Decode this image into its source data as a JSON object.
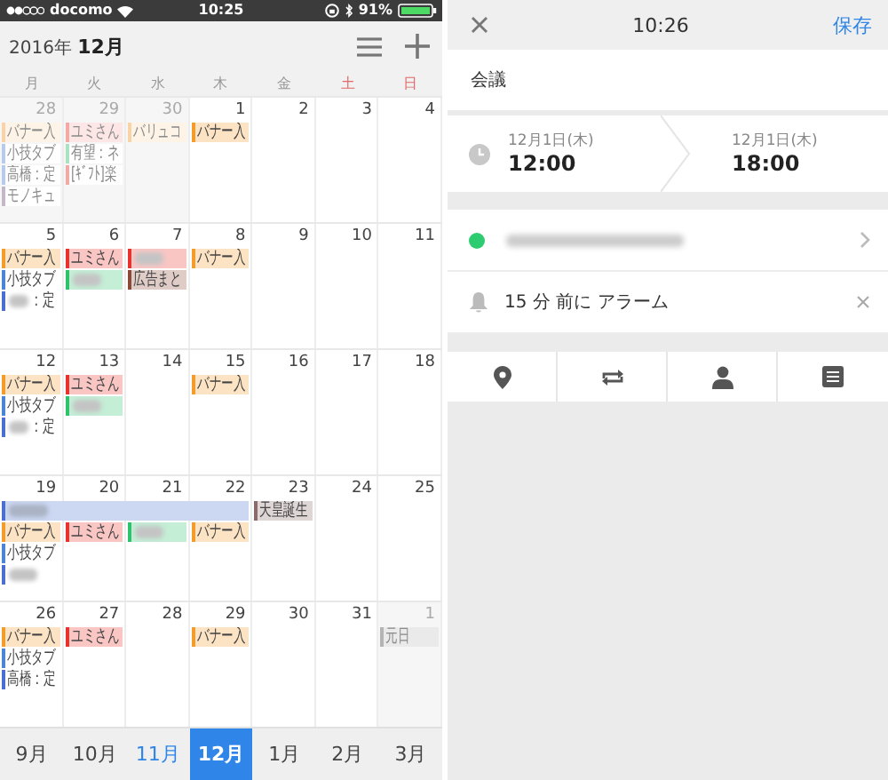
{
  "status_bar": {
    "carrier": "docomo",
    "time": "10:25",
    "battery": "91%"
  },
  "calendar_header": {
    "year": "2016年",
    "month": "12月"
  },
  "weekdays": [
    {
      "label": "月",
      "weekend": false
    },
    {
      "label": "火",
      "weekend": false
    },
    {
      "label": "水",
      "weekend": false
    },
    {
      "label": "木",
      "weekend": false
    },
    {
      "label": "金",
      "weekend": false
    },
    {
      "label": "土",
      "weekend": true
    },
    {
      "label": "日",
      "weekend": true
    }
  ],
  "weeks": [
    {
      "days": [
        {
          "date": "28",
          "outside": true,
          "events": [
            {
              "kind": "single",
              "text": "バナー入",
              "color": "#f8d3a8",
              "filled": true,
              "redacted": false
            },
            {
              "kind": "single",
              "text": "小技タブ",
              "color": "#b8cbec",
              "filled": false,
              "redacted": false
            },
            {
              "kind": "single",
              "text": "高橋：定",
              "color": "#b8cbec",
              "filled": false,
              "redacted": false
            },
            {
              "kind": "single",
              "text": "モノキュ",
              "color": "#c4b8c8",
              "filled": false,
              "redacted": false
            }
          ]
        },
        {
          "date": "29",
          "outside": true,
          "events": [
            {
              "kind": "single",
              "text": "ユミさん",
              "color": "#f3aaa7",
              "filled": true,
              "redacted": false
            },
            {
              "kind": "single",
              "text": "有望：ネ",
              "color": "#a9e3c2",
              "filled": false,
              "redacted": false
            },
            {
              "kind": "single",
              "text": "[ｷﾞﾌﾄ]楽",
              "color": "#f3aaa7",
              "filled": false,
              "redacted": false
            }
          ]
        },
        {
          "date": "30",
          "outside": true,
          "events": [
            {
              "kind": "single",
              "text": "バリュコ",
              "color": "#f8d3a8",
              "filled": true,
              "redacted": false
            }
          ]
        },
        {
          "date": "1",
          "outside": false,
          "events": [
            {
              "kind": "single",
              "text": "バナー入",
              "color": "#f39c2b",
              "filled": true,
              "redacted": false
            }
          ]
        },
        {
          "date": "2",
          "outside": false
        },
        {
          "date": "3",
          "outside": false
        },
        {
          "date": "4",
          "outside": false
        }
      ]
    },
    {
      "days": [
        {
          "date": "5",
          "outside": false,
          "events": [
            {
              "kind": "single",
              "text": "バナー入",
              "color": "#f39c2b",
              "filled": true,
              "redacted": false
            },
            {
              "kind": "single",
              "text": "小技タブ",
              "color": "#4a86d8",
              "filled": false,
              "redacted": false
            },
            {
              "kind": "single",
              "text": "：定",
              "color": "#4a6fd0",
              "filled": false,
              "redacted": true
            }
          ]
        },
        {
          "date": "6",
          "outside": false,
          "events": [
            {
              "kind": "single",
              "text": "ユミさん",
              "color": "#e8332c",
              "filled": true,
              "redacted": false
            },
            {
              "kind": "single",
              "color": "#2ec26b",
              "filled": true,
              "redacted": true
            }
          ]
        },
        {
          "date": "7",
          "outside": false,
          "events": [
            {
              "kind": "single",
              "color": "#e8332c",
              "filled": true,
              "redacted": true
            },
            {
              "kind": "single",
              "text": "広告まと",
              "color": "#8b4a38",
              "filled": true,
              "redacted": false
            }
          ]
        },
        {
          "date": "8",
          "outside": false,
          "events": [
            {
              "kind": "single",
              "text": "バナー入",
              "color": "#f39c2b",
              "filled": true,
              "redacted": false
            }
          ]
        },
        {
          "date": "9",
          "outside": false
        },
        {
          "date": "10",
          "outside": false
        },
        {
          "date": "11",
          "outside": false
        }
      ]
    },
    {
      "days": [
        {
          "date": "12",
          "outside": false,
          "events": [
            {
              "kind": "single",
              "text": "バナー入",
              "color": "#f39c2b",
              "filled": true,
              "redacted": false
            },
            {
              "kind": "single",
              "text": "小技タブ",
              "color": "#4a86d8",
              "filled": false,
              "redacted": false
            },
            {
              "kind": "single",
              "text": "：定",
              "color": "#4a6fd0",
              "filled": false,
              "redacted": true
            }
          ]
        },
        {
          "date": "13",
          "outside": false,
          "events": [
            {
              "kind": "single",
              "text": "ユミさん",
              "color": "#e8332c",
              "filled": true,
              "redacted": false
            },
            {
              "kind": "single",
              "color": "#2ec26b",
              "filled": true,
              "redacted": true
            }
          ]
        },
        {
          "date": "14",
          "outside": false
        },
        {
          "date": "15",
          "outside": false,
          "events": [
            {
              "kind": "single",
              "text": "バナー入",
              "color": "#f39c2b",
              "filled": true,
              "redacted": false
            }
          ]
        },
        {
          "date": "16",
          "outside": false
        },
        {
          "date": "17",
          "outside": false
        },
        {
          "date": "18",
          "outside": false
        }
      ]
    },
    {
      "days": [
        {
          "date": "19",
          "outside": false,
          "events": [
            {
              "kind": "multi-start",
              "color": "#4a6fd0",
              "filled": true,
              "redacted": true
            },
            {
              "kind": "single",
              "text": "バナー入",
              "color": "#f39c2b",
              "filled": true,
              "redacted": false
            },
            {
              "kind": "single",
              "text": "小技タブ",
              "color": "#4a86d8",
              "filled": false,
              "redacted": false
            },
            {
              "kind": "single",
              "color": "#4a6fd0",
              "filled": false,
              "redacted": true
            }
          ]
        },
        {
          "date": "20",
          "outside": false,
          "events": [
            {
              "kind": "continued"
            },
            {
              "kind": "single",
              "text": "ユミさん",
              "color": "#e8332c",
              "filled": true,
              "redacted": false
            }
          ]
        },
        {
          "date": "21",
          "outside": false,
          "events": [
            {
              "kind": "continued"
            },
            {
              "kind": "single",
              "color": "#2ec26b",
              "filled": true,
              "redacted": true
            }
          ]
        },
        {
          "date": "22",
          "outside": false,
          "events": [
            {
              "kind": "continued"
            },
            {
              "kind": "single",
              "text": "バナー入",
              "color": "#f39c2b",
              "filled": true,
              "redacted": false
            }
          ]
        },
        {
          "date": "23",
          "outside": false,
          "events": [
            {
              "kind": "single",
              "text": "天皇誕生",
              "color": "#8a6a6a",
              "filled": true,
              "redacted": false
            }
          ]
        },
        {
          "date": "24",
          "outside": false
        },
        {
          "date": "25",
          "outside": false
        }
      ]
    },
    {
      "days": [
        {
          "date": "26",
          "outside": false,
          "events": [
            {
              "kind": "single",
              "text": "バナー入",
              "color": "#f39c2b",
              "filled": true,
              "redacted": false
            },
            {
              "kind": "single",
              "text": "小技タブ",
              "color": "#4a86d8",
              "filled": false,
              "redacted": false
            },
            {
              "kind": "single",
              "text": "高橋：定",
              "color": "#4a6fd0",
              "filled": false,
              "redacted": false
            }
          ]
        },
        {
          "date": "27",
          "outside": false,
          "events": [
            {
              "kind": "single",
              "text": "ユミさん",
              "color": "#e8332c",
              "filled": true,
              "redacted": false
            }
          ]
        },
        {
          "date": "28",
          "outside": false
        },
        {
          "date": "29",
          "outside": false,
          "events": [
            {
              "kind": "single",
              "text": "バナー入",
              "color": "#f39c2b",
              "filled": true,
              "redacted": false
            }
          ]
        },
        {
          "date": "30",
          "outside": false
        },
        {
          "date": "31",
          "outside": false
        },
        {
          "date": "1",
          "outside": true,
          "events": [
            {
              "kind": "single",
              "text": "元日",
              "color": "#b4b4b4",
              "filled": true,
              "redacted": false
            }
          ]
        }
      ]
    }
  ],
  "months": [
    {
      "label": "9月",
      "selected": false,
      "current": false
    },
    {
      "label": "10月",
      "selected": false,
      "current": false
    },
    {
      "label": "11月",
      "selected": false,
      "current": true
    },
    {
      "label": "12月",
      "selected": true,
      "current": false
    },
    {
      "label": "1月",
      "selected": false,
      "current": false
    },
    {
      "label": "2月",
      "selected": false,
      "current": false
    },
    {
      "label": "3月",
      "selected": false,
      "current": false
    }
  ],
  "editor": {
    "time": "10:26",
    "save": "保存",
    "title": "会議",
    "start": {
      "date": "12月1日(木)",
      "time": "12:00"
    },
    "end": {
      "date": "12月1日(木)",
      "time": "18:00"
    },
    "calendar": {
      "color": "#2ecc71"
    },
    "alarm": "15 分 前に アラーム"
  }
}
